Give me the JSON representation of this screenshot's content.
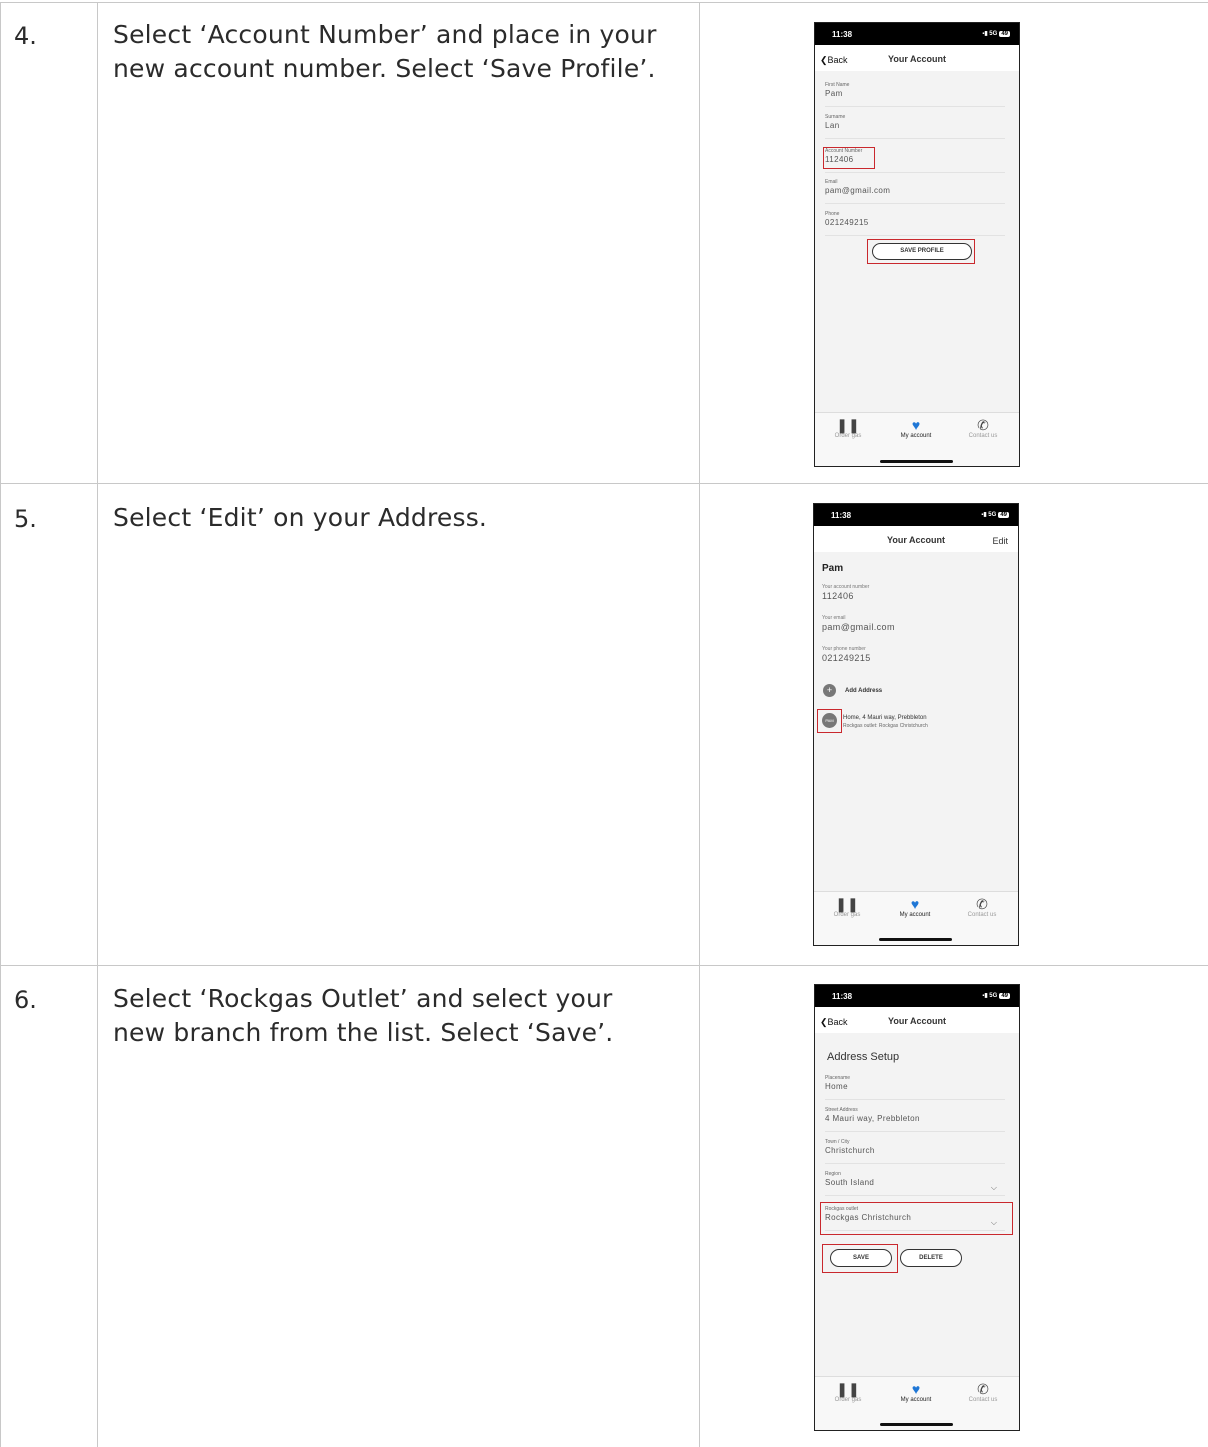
{
  "steps": [
    {
      "number": "4.",
      "line1": "Select ‘Account Number’ and place in your",
      "line2": "new account number. Select ‘Save Profile’."
    },
    {
      "number": "5.",
      "line1": "Select ‘Edit’ on your Address.",
      "line2": ""
    },
    {
      "number": "6.",
      "line1": "Select ‘Rockgas Outlet’ and select your",
      "line2": "new branch from the list. Select ‘Save’."
    }
  ],
  "status_bar": {
    "time": "11:38",
    "network": "5G",
    "battery": "49"
  },
  "tabs": {
    "order": "Order gas",
    "account": "My account",
    "contact": "Contact us"
  },
  "screen1": {
    "back": "Back",
    "title": "Your Account",
    "fields": [
      {
        "label": "First Name",
        "value": "Pam"
      },
      {
        "label": "Surname",
        "value": "Lan"
      },
      {
        "label": "Account Number",
        "value": "112406"
      },
      {
        "label": "Email",
        "value": "pam@gmail.com"
      },
      {
        "label": "Phone",
        "value": "021249215"
      }
    ],
    "save_button": "SAVE PROFILE"
  },
  "screen2": {
    "title": "Your Account",
    "edit": "Edit",
    "name": "Pam",
    "account_label": "Your account number",
    "account_value": "112406",
    "email_label": "Your email",
    "email_value": "pam@gmail.com",
    "phone_label": "Your phone number",
    "phone_value": "021249215",
    "add_address": "Add Address",
    "address_badge": "PAM",
    "address_line": "Home, 4 Mauri way, Prebbleton",
    "outlet_line": "Rockgas outlet: Rockgas Christchurch"
  },
  "screen3": {
    "back": "Back",
    "title": "Your Account",
    "header": "Address Setup",
    "fields": [
      {
        "label": "Placename",
        "value": "Home"
      },
      {
        "label": "Street Address",
        "value": "4 Mauri way, Prebbleton"
      },
      {
        "label": "Town / City",
        "value": "Christchurch"
      },
      {
        "label": "Region",
        "value": "South Island"
      },
      {
        "label": "Rockgas outlet",
        "value": "Rockgas Christchurch"
      }
    ],
    "save": "SAVE",
    "delete": "DELETE"
  }
}
